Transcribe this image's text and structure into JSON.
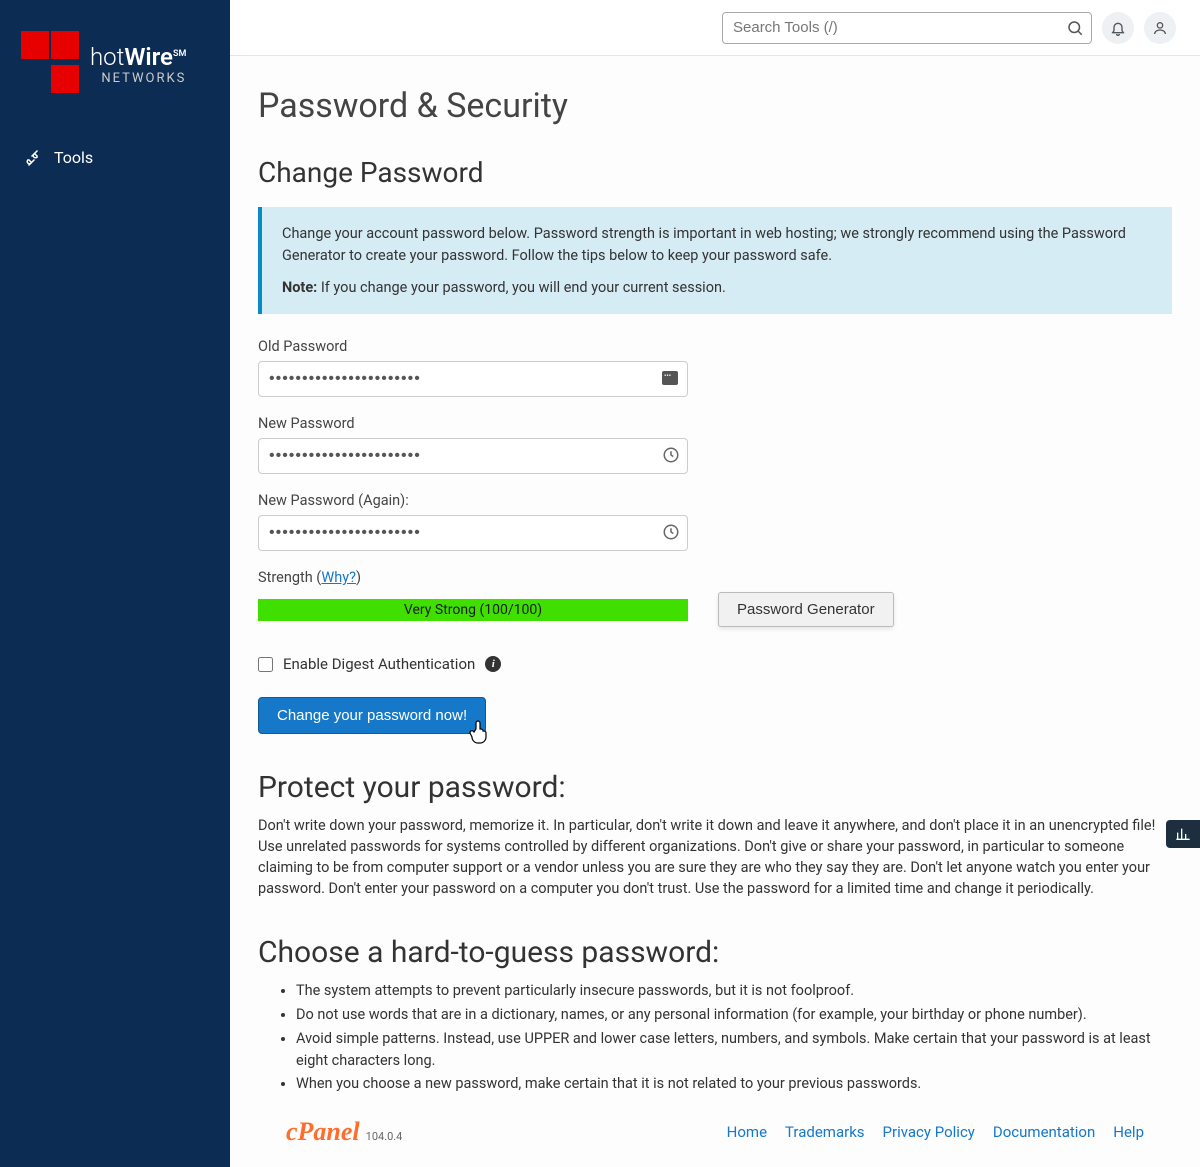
{
  "brand": {
    "name_prefix": "hot",
    "name_suffix": "Wire",
    "badge": "SM",
    "subtitle": "NETWORKS"
  },
  "sidebar": {
    "items": [
      {
        "label": "Tools"
      }
    ]
  },
  "topbar": {
    "search_placeholder": "Search Tools (/)"
  },
  "page": {
    "title": "Password & Security",
    "section": "Change Password",
    "info_text": "Change your account password below. Password strength is important in web hosting; we strongly recommend using the Password Generator to create your password. Follow the tips below to keep your password safe.",
    "note_label": "Note:",
    "note_text": " If you change your password, you will end your current session."
  },
  "form": {
    "old_label": "Old Password",
    "old_value": "•••••••••••••••••••••••",
    "new_label": "New Password",
    "new_value": "•••••••••••••••••••••••",
    "again_label": "New Password (Again):",
    "again_value": "•••••••••••••••••••••••",
    "strength_label_pre": "Strength (",
    "strength_label_link": "Why?",
    "strength_label_post": ")",
    "strength_text": "Very Strong (100/100)",
    "generator_btn": "Password Generator",
    "digest_label": "Enable Digest Authentication",
    "submit_btn": "Change your password now!"
  },
  "tips": {
    "protect_title": "Protect your password:",
    "protect_text": "Don't write down your password, memorize it. In particular, don't write it down and leave it anywhere, and don't place it in an unencrypted file! Use unrelated passwords for systems controlled by different organizations. Don't give or share your password, in particular to someone claiming to be from computer support or a vendor unless you are sure they are who they say they are. Don't let anyone watch you enter your password. Don't enter your password on a computer you don't trust. Use the password for a limited time and change it periodically.",
    "choose_title": "Choose a hard-to-guess password:",
    "list": [
      "The system attempts to prevent particularly insecure passwords, but it is not foolproof.",
      "Do not use words that are in a dictionary, names, or any personal information (for example, your birthday or phone number).",
      "Avoid simple patterns. Instead, use UPPER and lower case letters, numbers, and symbols. Make certain that your password is at least eight characters long.",
      "When you choose a new password, make certain that it is not related to your previous passwords."
    ]
  },
  "footer": {
    "product": "cPanel",
    "version": "104.0.4",
    "links": [
      "Home",
      "Trademarks",
      "Privacy Policy",
      "Documentation",
      "Help"
    ]
  }
}
